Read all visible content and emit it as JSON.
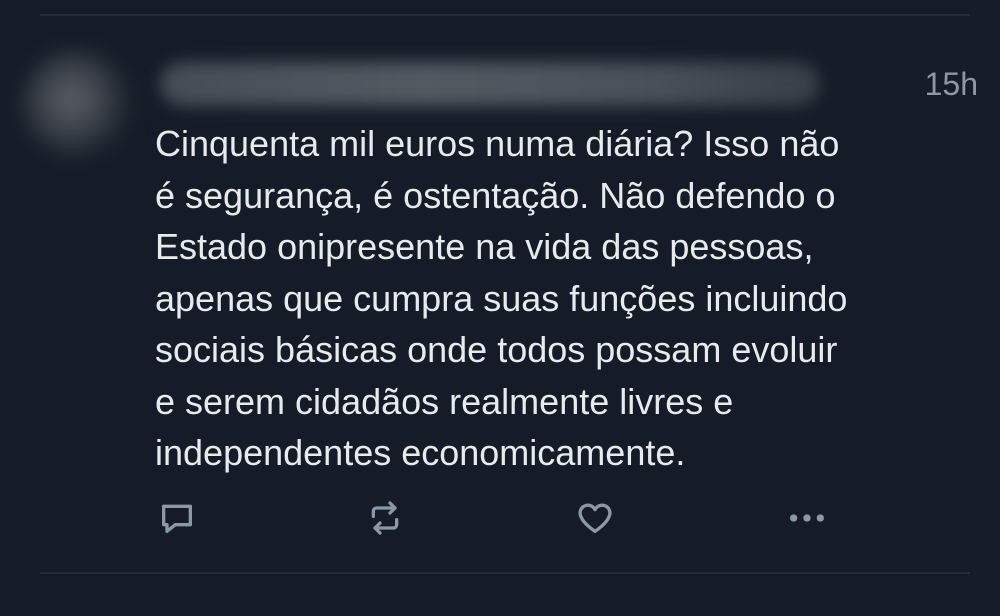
{
  "tweet": {
    "timestamp": "15h",
    "text": "Cinquenta mil euros numa diária? Isso não\né segurança, é ostentação. Não defendo o\nEstado onipresente na vida das pessoas,\napenas que cumpra suas funções incluindo\nsociais básicas onde todos possam evoluir\ne serem cidadãos realmente livres e\nindependentes economicamente."
  },
  "actions": [
    {
      "icon": "reply-icon"
    },
    {
      "icon": "retweet-icon"
    },
    {
      "icon": "like-icon"
    },
    {
      "icon": "more-icon"
    }
  ],
  "colors": {
    "background": "#151c27",
    "text": "#e7ebee",
    "muted": "#8b98a5",
    "icon": "#8b98a5"
  }
}
